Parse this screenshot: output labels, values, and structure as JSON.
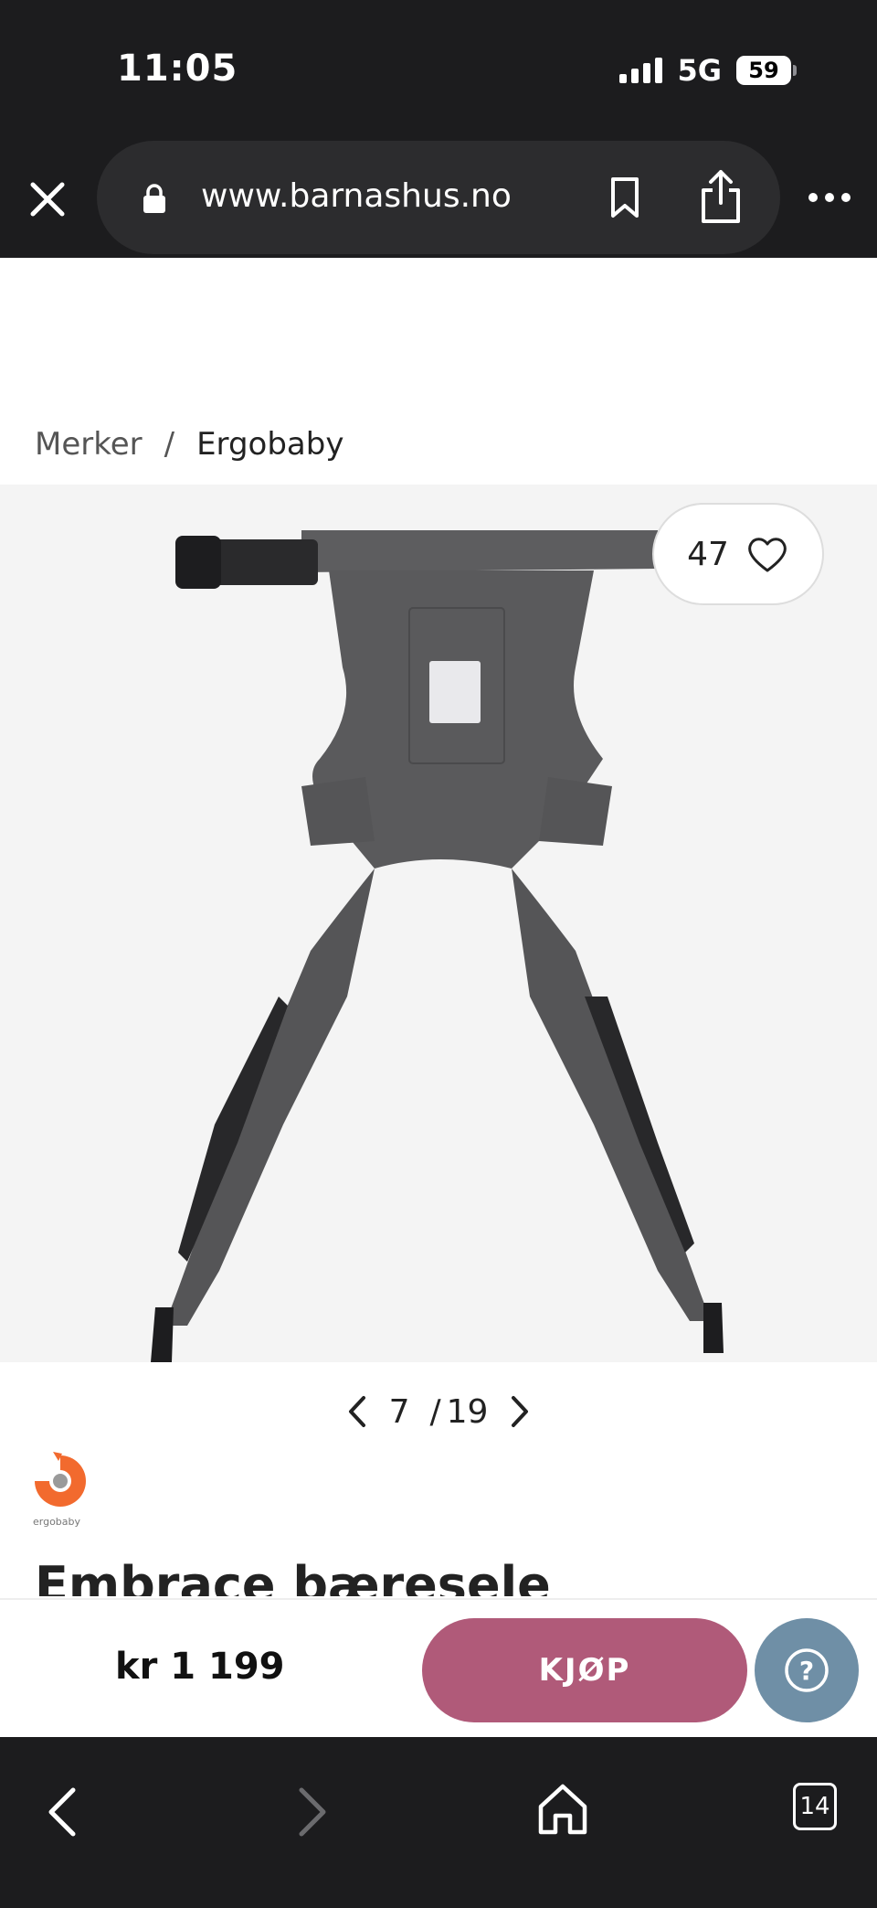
{
  "status_bar": {
    "time": "11:05",
    "network": "5G",
    "battery": "59"
  },
  "browser": {
    "url": "www.barnashus.no"
  },
  "breadcrumb": {
    "items": [
      "Merker",
      "/",
      "Ergobaby"
    ]
  },
  "gallery": {
    "likes": "47",
    "current": "7",
    "separator": "/",
    "total": "19"
  },
  "product": {
    "brand_logo": "ergobaby",
    "title": "Embrace bæresele"
  },
  "buy_bar": {
    "price": "kr 1 199",
    "buy_label": "KJØP",
    "help_label": "?"
  },
  "bottom_nav": {
    "tabs_count": "14"
  },
  "colors": {
    "buy_button": "#b05a79",
    "help_button": "#6f8fa6",
    "chrome": "#1c1c1e"
  }
}
